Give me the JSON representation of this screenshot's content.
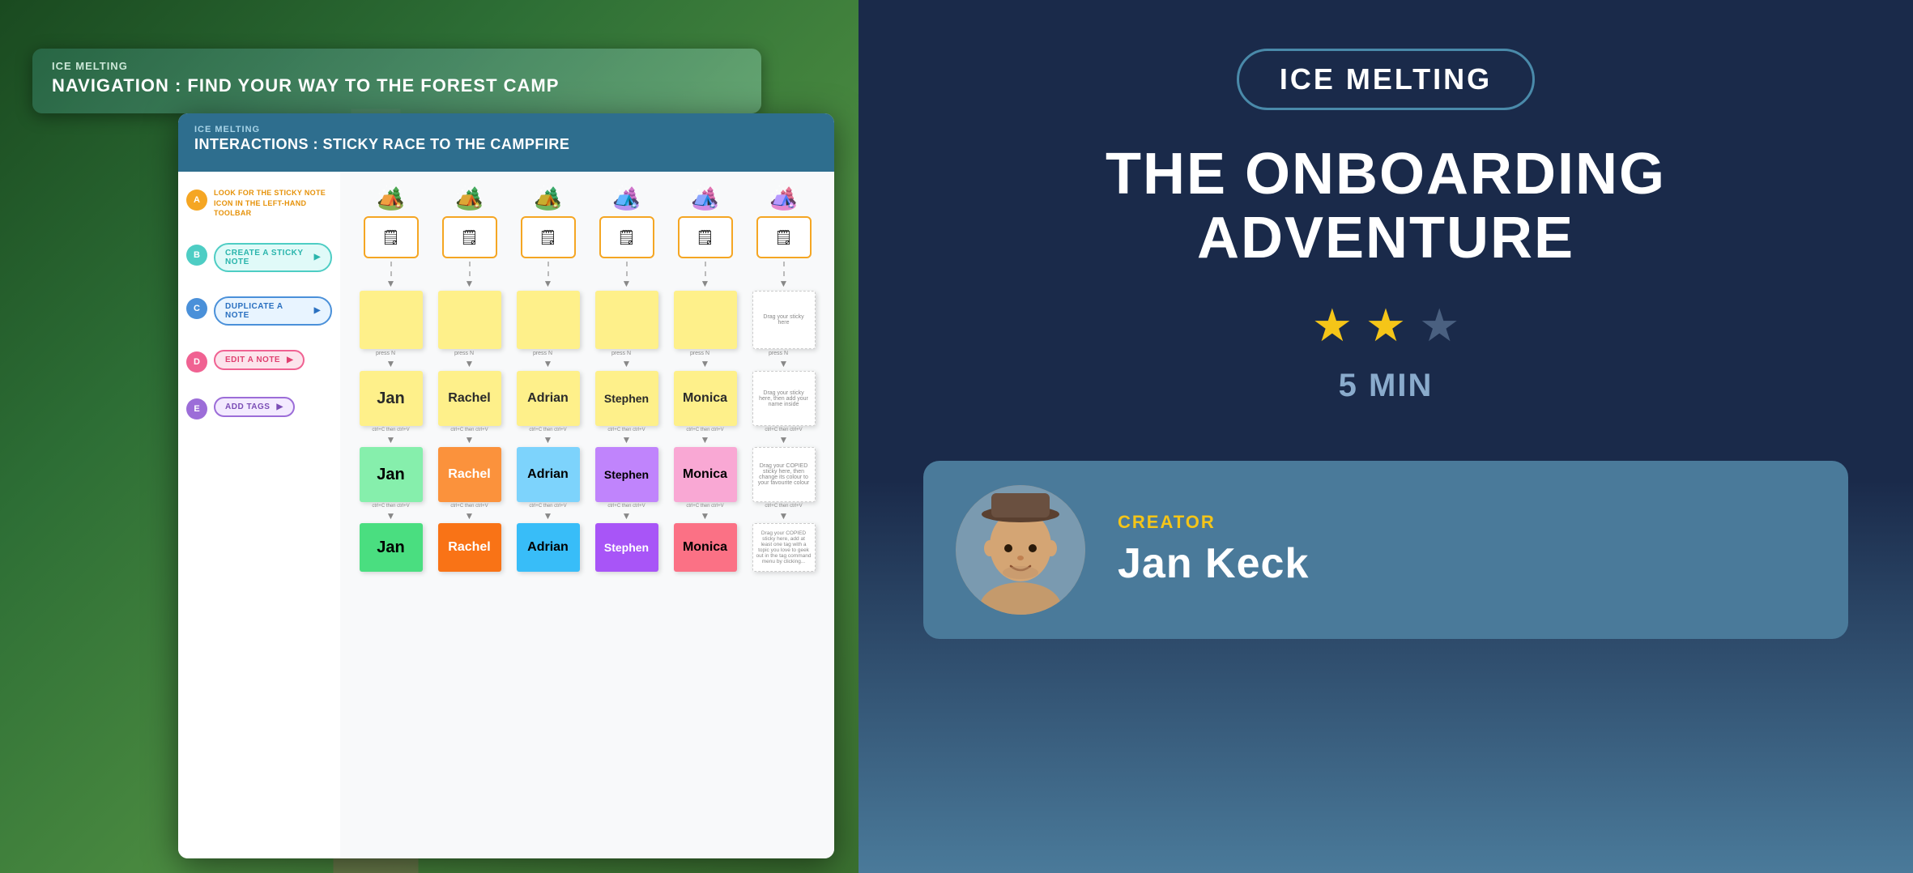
{
  "left_panel": {
    "nav_card": {
      "subtitle": "ICE MELTING",
      "title": "NAVIGATION : FIND YOUR WAY TO THE FOREST CAMP"
    },
    "main_card": {
      "subtitle": "ICE MELTING",
      "title": "INTERACTIONS : STICKY RACE TO THE CAMPFIRE"
    },
    "steps": [
      {
        "id": "A",
        "color": "yellow",
        "text": "LOOK FOR THE STICKY NOTE ICON IN THE LEFT-HAND TOOLBAR"
      },
      {
        "id": "B",
        "color": "teal",
        "label": "CREATE A STICKY NOTE"
      },
      {
        "id": "C",
        "color": "blue",
        "label": "DUPLICATE A NOTE"
      },
      {
        "id": "D",
        "color": "pink",
        "label": "EDIT A NOTE"
      },
      {
        "id": "E",
        "color": "purple",
        "label": "ADD TAGS"
      }
    ],
    "grid": {
      "tents": [
        "⛺",
        "⛺",
        "⛺",
        "⛺",
        "⛺",
        "⛺"
      ],
      "press_labels": [
        "press N",
        "press N",
        "press N",
        "press N",
        "press N",
        "press N"
      ],
      "ctrl_labels": [
        "ctrl+C then ctrl+V",
        "ctrl+C then ctrl+V",
        "ctrl+C then ctrl+V",
        "ctrl+C then ctrl+V",
        "ctrl+C then ctrl+V",
        "ctrl+C then ctrl+V"
      ],
      "names": [
        "Jan",
        "Rachel",
        "Adrian",
        "Stephen",
        "Monica",
        ""
      ],
      "colored_names": [
        "Jan",
        "Rachel",
        "Adrian",
        "Stephen",
        "Monica",
        ""
      ],
      "bottom_names": [
        "Jan",
        "Rachel",
        "Adrian",
        "Stephen",
        "Monica",
        ""
      ],
      "empty_note_text": "Drag your sticky here",
      "empty_note_text2": "Drag your sticky here, then add your name inside",
      "empty_note_text3": "Drag your COPIED sticky here, then change its colour to your favourite colour",
      "empty_note_text4": "Drag your COPIED sticky here, add at least one tag with a topic you love to geek out in the tag command menu by clicking..."
    }
  },
  "right_panel": {
    "badge_text": "ICE MELTING",
    "title_line1": "THE ONBOARDING",
    "title_line2": "ADVENTURE",
    "stars": {
      "filled": 2,
      "empty": 1,
      "total": 3
    },
    "duration": "5 MIN",
    "creator": {
      "label": "CREATOR",
      "name": "Jan Keck"
    }
  }
}
